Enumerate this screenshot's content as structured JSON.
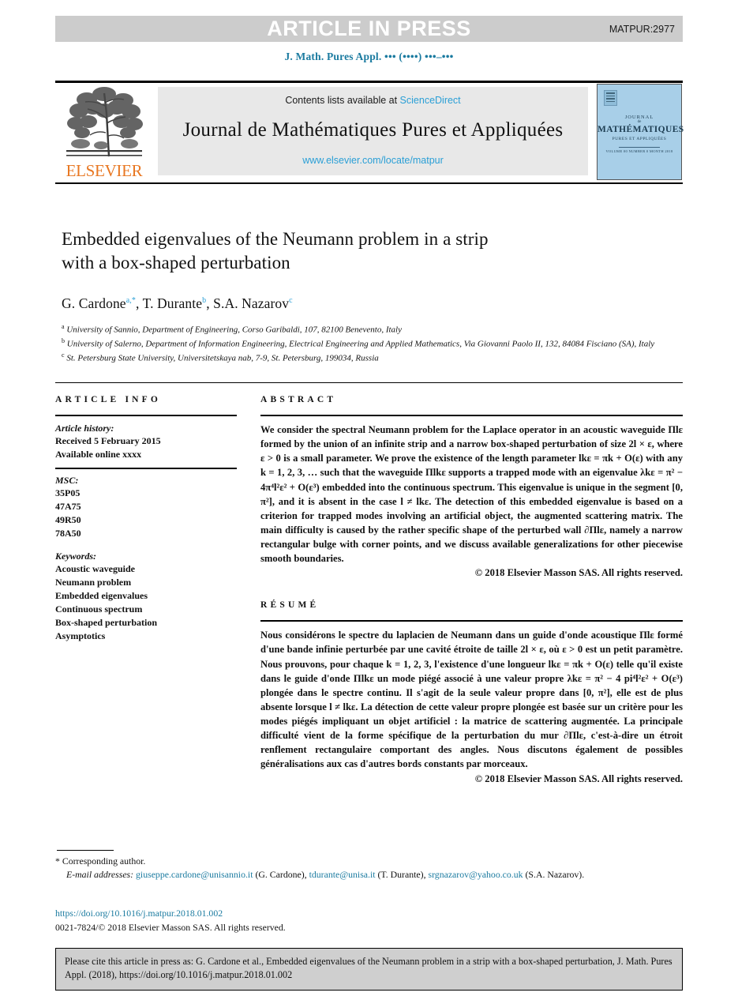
{
  "banner": {
    "press_label": "ARTICLE IN PRESS",
    "manuscript_id": "MATPUR:2977",
    "bar_color": "#cccccc"
  },
  "running_head": {
    "journal_line": "J. Math. Pures Appl. ••• (••••) •••–•••",
    "color": "#1b7ba0"
  },
  "masthead": {
    "publisher": "ELSEVIER",
    "publisher_color": "#e87722",
    "contents_prefix": "Contents lists available at ",
    "contents_link": "ScienceDirect",
    "journal_title": "Journal de Mathématiques Pures et Appliquées",
    "journal_url": "www.elsevier.com/locate/matpur",
    "link_color": "#2a9fd6",
    "cover": {
      "line1": "JOURNAL",
      "line2": "de",
      "line3": "MATHÉMATIQUES",
      "line4": "PURES ET APPLIQUÉES",
      "line5": "VOLUME 00 NUMBER 0 MONTH 2018"
    }
  },
  "article": {
    "title_line1": "Embedded eigenvalues of the Neumann problem in a strip",
    "title_line2": "with a box-shaped perturbation",
    "authors": [
      {
        "name": "G. Cardone",
        "marks": "a,*"
      },
      {
        "name": "T. Durante",
        "marks": "b"
      },
      {
        "name": "S.A. Nazarov",
        "marks": "c"
      }
    ],
    "affiliations": [
      {
        "mark": "a",
        "text": "University of Sannio, Department of Engineering, Corso Garibaldi, 107, 82100 Benevento, Italy"
      },
      {
        "mark": "b",
        "text": "University of Salerno, Department of Information Engineering, Electrical Engineering and Applied Mathematics, Via Giovanni Paolo II, 132, 84084 Fisciano (SA), Italy"
      },
      {
        "mark": "c",
        "text": "St. Petersburg State University, Universitetskaya nab, 7-9, St. Petersburg, 199034, Russia"
      }
    ]
  },
  "article_info": {
    "heading": "ARTICLE INFO",
    "history_label": "Article history:",
    "history_lines": [
      "Received 5 February 2015",
      "Available online xxxx"
    ],
    "msc_label": "MSC:",
    "msc_codes": [
      "35P05",
      "47A75",
      "49R50",
      "78A50"
    ],
    "keywords_label": "Keywords:",
    "keywords": [
      "Acoustic waveguide",
      "Neumann problem",
      "Embedded eigenvalues",
      "Continuous spectrum",
      "Box-shaped perturbation",
      "Asymptotics"
    ]
  },
  "abstract": {
    "heading": "ABSTRACT",
    "text": "We consider the spectral Neumann problem for the Laplace operator in an acoustic waveguide Πlε formed by the union of an infinite strip and a narrow box-shaped perturbation of size 2l × ε, where ε > 0 is a small parameter. We prove the existence of the length parameter lkε = πk + O(ε) with any k = 1, 2, 3, … such that the waveguide Πlkε supports a trapped mode with an eigenvalue λkε = π² − 4π⁴l²ε² + O(ε³) embedded into the continuous spectrum. This eigenvalue is unique in the segment [0, π²], and it is absent in the case l ≠ lkε. The detection of this embedded eigenvalue is based on a criterion for trapped modes involving an artificial object, the augmented scattering matrix. The main difficulty is caused by the rather specific shape of the perturbed wall ∂Πlε, namely a narrow rectangular bulge with corner points, and we discuss available generalizations for other piecewise smooth boundaries.",
    "copyright": "© 2018 Elsevier Masson SAS. All rights reserved."
  },
  "resume": {
    "heading": "RÉSUMÉ",
    "text": "Nous considérons le spectre du laplacien de Neumann dans un guide d'onde acoustique Πlε formé d'une bande infinie perturbée par une cavité étroite de taille 2l × ε, où ε > 0 est un petit paramètre. Nous prouvons, pour chaque k = 1, 2, 3, l'existence d'une longueur lkε = πk + O(ε) telle qu'il existe dans le guide d'onde Πlkε un mode piégé associé à une valeur propre λkε = π² − 4 pi⁴l²ε² + O(ε³) plongée dans le spectre continu. Il s'agit de la seule valeur propre dans [0, π²], elle est de plus absente lorsque l ≠ lkε. La détection de cette valeur propre plongée est basée sur un critère pour les modes piégés impliquant un objet artificiel : la matrice de scattering augmentée. La principale difficulté vient de la forme spécifique de la perturbation du mur ∂Πlε, c'est-à-dire un étroit renflement rectangulaire comportant des angles. Nous discutons également de possibles généralisations aux cas d'autres bords constants par morceaux.",
    "copyright": "© 2018 Elsevier Masson SAS. All rights reserved."
  },
  "footnotes": {
    "corresponding_mark": "*",
    "corresponding_text": "Corresponding author.",
    "email_label": "E-mail addresses:",
    "emails": [
      {
        "address": "giuseppe.cardone@unisannio.it",
        "owner": "(G. Cardone)"
      },
      {
        "address": "tdurante@unisa.it",
        "owner": "(T. Durante)"
      },
      {
        "address": "srgnazarov@yahoo.co.uk",
        "owner": "(S.A. Nazarov)."
      }
    ],
    "doi": "https://doi.org/10.1016/j.matpur.2018.01.002",
    "issn_line": "0021-7824/© 2018 Elsevier Masson SAS. All rights reserved."
  },
  "cite_box": {
    "text": "Please cite this article in press as: G. Cardone et al., Embedded eigenvalues of the Neumann problem in a strip with a box-shaped perturbation, J. Math. Pures Appl. (2018), https://doi.org/10.1016/j.matpur.2018.01.002",
    "bg_color": "#cfcfcf"
  }
}
